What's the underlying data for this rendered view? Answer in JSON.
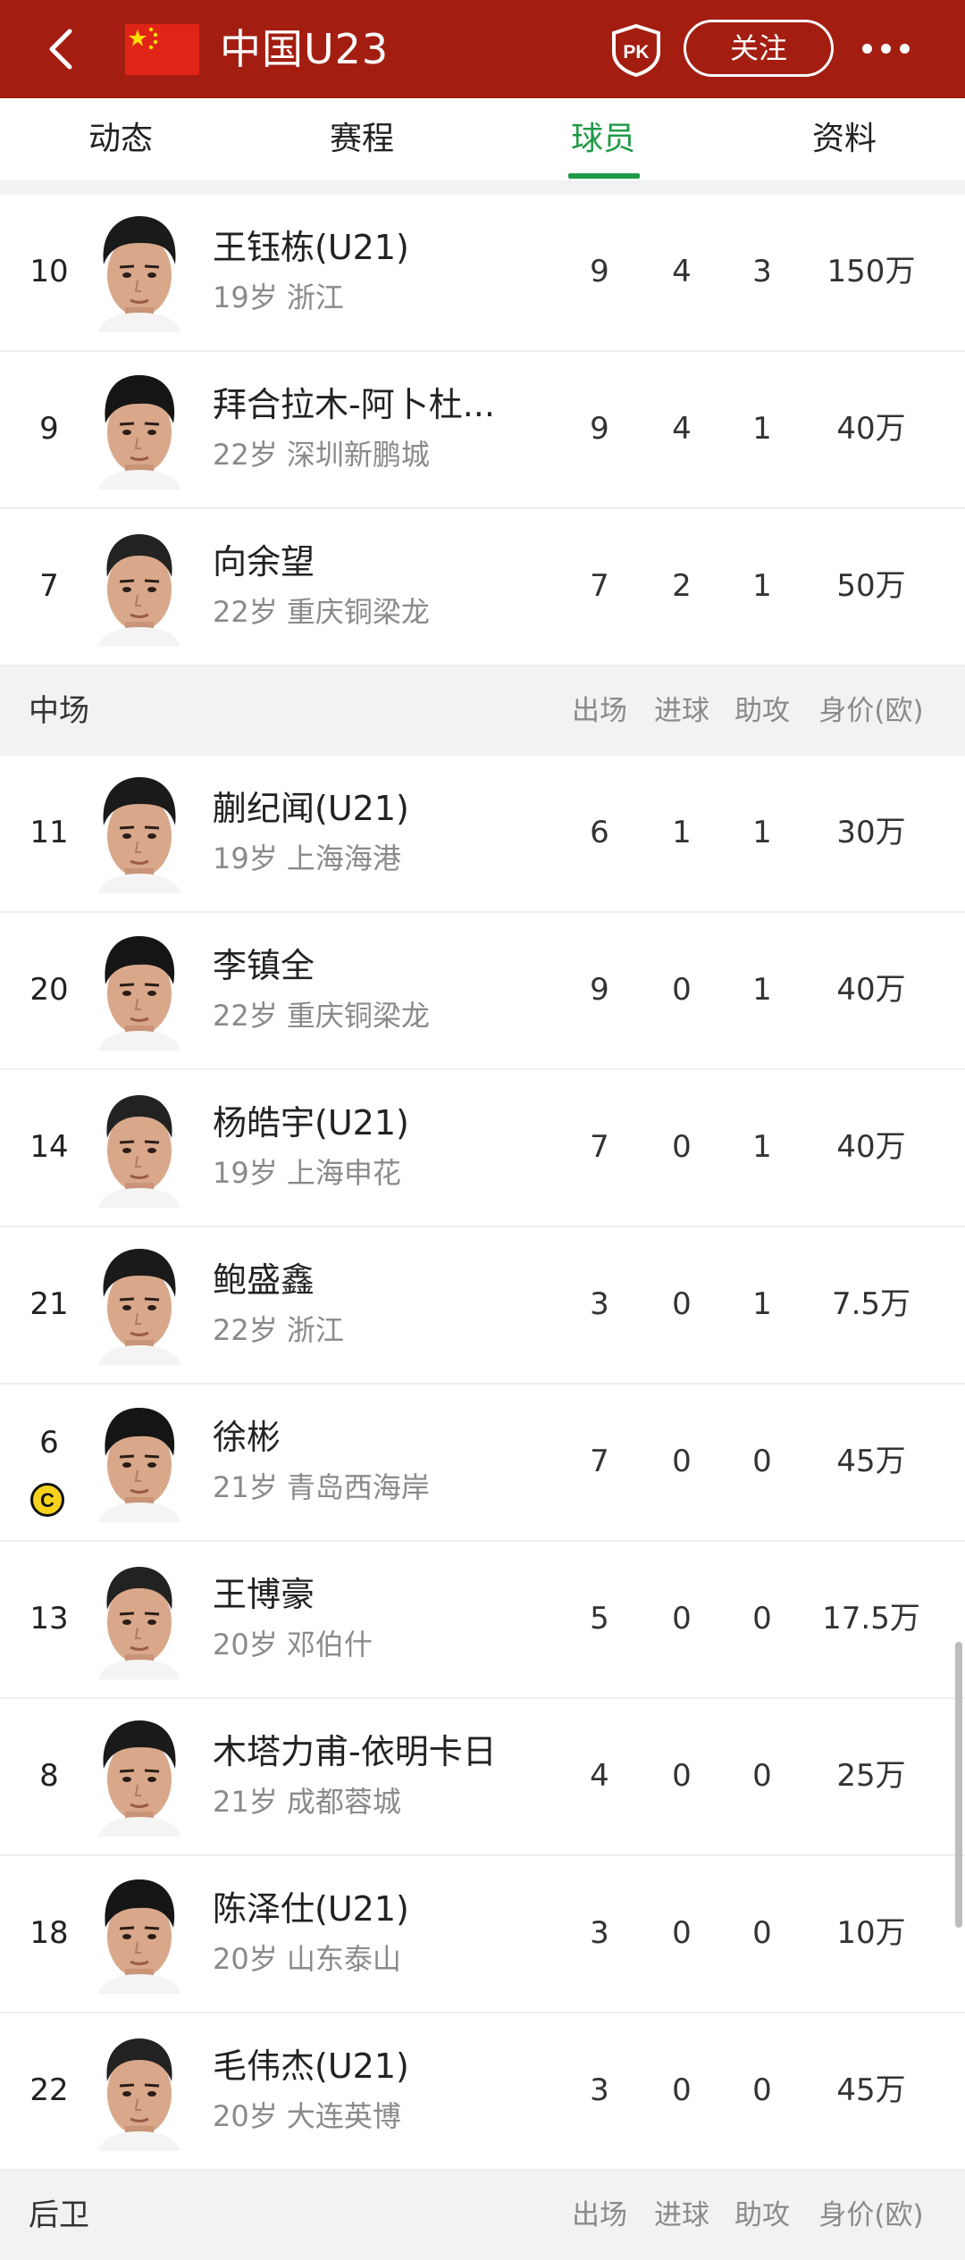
{
  "header": {
    "title": "中国U23",
    "follow_label": "关注",
    "pk_label": "PK",
    "brand_color": "#a31e11"
  },
  "tabs": [
    {
      "label": "动态",
      "active": false
    },
    {
      "label": "赛程",
      "active": false
    },
    {
      "label": "球员",
      "active": true
    },
    {
      "label": "资料",
      "active": false
    }
  ],
  "columns": [
    "出场",
    "进球",
    "助攻",
    "身价(欧)"
  ],
  "top_rows": [
    {
      "num": "10",
      "name": "王钰栋(U21)",
      "sub": "19岁  浙江",
      "apps": "9",
      "goals": "4",
      "assists": "3",
      "value": "150万"
    },
    {
      "num": "9",
      "name": "拜合拉木-阿卜杜...",
      "sub": "22岁  深圳新鹏城",
      "apps": "9",
      "goals": "4",
      "assists": "1",
      "value": "40万"
    },
    {
      "num": "7",
      "name": "向余望",
      "sub": "22岁  重庆铜梁龙",
      "apps": "7",
      "goals": "2",
      "assists": "1",
      "value": "50万"
    }
  ],
  "midfield": {
    "title": "中场",
    "rows": [
      {
        "num": "11",
        "name": "蒯纪闻(U21)",
        "sub": "19岁  上海海港",
        "apps": "6",
        "goals": "1",
        "assists": "1",
        "value": "30万"
      },
      {
        "num": "20",
        "name": "李镇全",
        "sub": "22岁  重庆铜梁龙",
        "apps": "9",
        "goals": "0",
        "assists": "1",
        "value": "40万"
      },
      {
        "num": "14",
        "name": "杨皓宇(U21)",
        "sub": "19岁  上海申花",
        "apps": "7",
        "goals": "0",
        "assists": "1",
        "value": "40万"
      },
      {
        "num": "21",
        "name": "鲍盛鑫",
        "sub": "22岁  浙江",
        "apps": "3",
        "goals": "0",
        "assists": "1",
        "value": "7.5万"
      },
      {
        "num": "6",
        "name": "徐彬",
        "sub": "21岁  青岛西海岸",
        "apps": "7",
        "goals": "0",
        "assists": "0",
        "value": "45万",
        "captain": true
      },
      {
        "num": "13",
        "name": "王博豪",
        "sub": "20岁  邓伯什",
        "apps": "5",
        "goals": "0",
        "assists": "0",
        "value": "17.5万"
      },
      {
        "num": "8",
        "name": "木塔力甫-依明卡日",
        "sub": "21岁  成都蓉城",
        "apps": "4",
        "goals": "0",
        "assists": "0",
        "value": "25万"
      },
      {
        "num": "18",
        "name": "陈泽仕(U21)",
        "sub": "20岁  山东泰山",
        "apps": "3",
        "goals": "0",
        "assists": "0",
        "value": "10万"
      },
      {
        "num": "22",
        "name": "毛伟杰(U21)",
        "sub": "20岁  大连英博",
        "apps": "3",
        "goals": "0",
        "assists": "0",
        "value": "45万"
      }
    ]
  },
  "defense": {
    "title": "后卫"
  },
  "captain_label": "C",
  "accent_color": "#1f9a46"
}
